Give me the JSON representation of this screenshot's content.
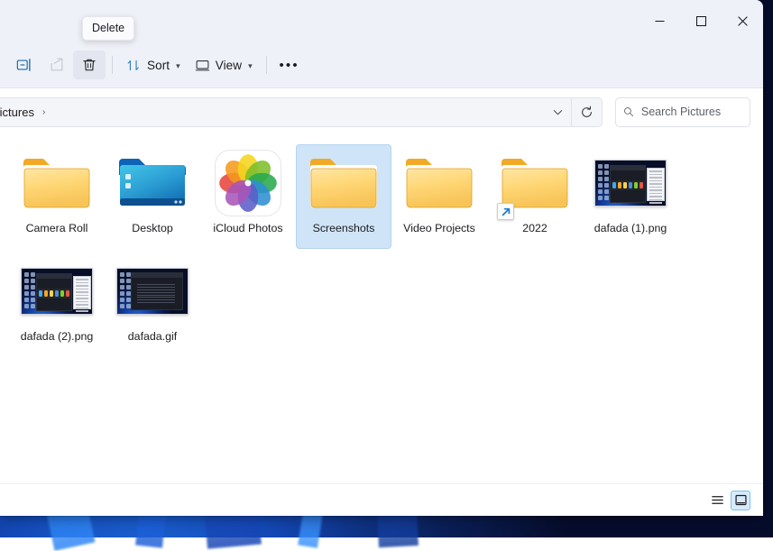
{
  "window": {
    "title": "Pictures",
    "controls": {
      "minimize": "minimize",
      "maximize": "maximize",
      "close": "close"
    }
  },
  "tooltip": {
    "text": "Delete",
    "for": "delete-button"
  },
  "toolbar": {
    "rename_label": "Rename",
    "share_label": "Share",
    "delete_label": "Delete",
    "sort_label": "Sort",
    "view_label": "View",
    "more_label": "See more",
    "more_glyph": "•••"
  },
  "address": {
    "breadcrumbs": [
      {
        "label": "Pictures"
      }
    ],
    "separator": "›",
    "dropdown_label": "Previous locations",
    "refresh_label": "Refresh"
  },
  "search": {
    "placeholder": "Search Pictures",
    "value": "",
    "icon": "search-icon"
  },
  "files": [
    {
      "name": "Camera Roll",
      "type": "folder",
      "icon": "folder-yellow-icon",
      "selected": false,
      "shortcut": false
    },
    {
      "name": "Desktop",
      "type": "folder",
      "icon": "folder-desktop-icon",
      "selected": false,
      "shortcut": false
    },
    {
      "name": "iCloud Photos",
      "type": "folder",
      "icon": "icloud-photos-icon",
      "selected": false,
      "shortcut": false
    },
    {
      "name": "Screenshots",
      "type": "folder",
      "icon": "folder-yellow-icon",
      "selected": true,
      "shortcut": false
    },
    {
      "name": "Video Projects",
      "type": "folder",
      "icon": "folder-yellow-icon",
      "selected": false,
      "shortcut": false
    },
    {
      "name": "2022",
      "type": "folder-shortcut",
      "icon": "folder-yellow-icon",
      "selected": false,
      "shortcut": true
    },
    {
      "name": "dafada  (1).png",
      "type": "image",
      "icon": "image-thumbnail",
      "selected": false,
      "shortcut": false
    },
    {
      "name": "dafada  (2).png",
      "type": "image",
      "icon": "image-thumbnail",
      "selected": false,
      "shortcut": false
    },
    {
      "name": "dafada.gif",
      "type": "image",
      "icon": "image-thumbnail-dark",
      "selected": false,
      "shortcut": false
    }
  ],
  "statusbar": {
    "list_view_label": "Details view",
    "grid_view_label": "Large icons view",
    "active_view": "grid"
  },
  "colors": {
    "accent": "#0f6cbd",
    "selection_fill": "#cfe4f7",
    "selection_border": "#b4d4f0",
    "chrome": "#eef1f8",
    "folder_yellow": "#ffd675",
    "folder_yellow_dark": "#f5b43c",
    "desktop_wallpaper": "#0a1226",
    "text": "#1b1b1f"
  }
}
